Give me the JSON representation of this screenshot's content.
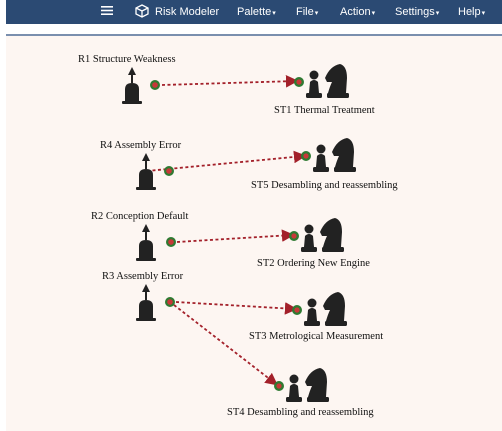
{
  "navbar": {
    "brand": "Risk Modeler",
    "menu": [
      {
        "label": "Palette"
      },
      {
        "label": "File"
      },
      {
        "label": "Action"
      },
      {
        "label": "Settings"
      },
      {
        "label": "Help"
      }
    ],
    "background_color": "#2b4a73"
  },
  "canvas": {
    "background_color": "#fdf6f2",
    "link_color": "#a3202a",
    "port_colors": {
      "inner": "#c83838",
      "outer": "#2f7a32"
    },
    "risks": [
      {
        "id": "R1",
        "label": "R1 Structure Weakness"
      },
      {
        "id": "R4",
        "label": "R4 Assembly Error"
      },
      {
        "id": "R2",
        "label": "R2 Conception Default"
      },
      {
        "id": "R3",
        "label": "R3 Assembly Error"
      }
    ],
    "strategies": [
      {
        "id": "ST1",
        "label": "ST1 Thermal Treatment"
      },
      {
        "id": "ST5",
        "label": "ST5 Desambling and reassembling"
      },
      {
        "id": "ST2",
        "label": "ST2 Ordering New Engine"
      },
      {
        "id": "ST3",
        "label": "ST3 Metrological Measurement"
      },
      {
        "id": "ST4",
        "label": "ST4 Desambling and reassembling"
      }
    ],
    "links": [
      {
        "from": "R1",
        "to": "ST1"
      },
      {
        "from": "R4",
        "to": "ST5"
      },
      {
        "from": "R2",
        "to": "ST2"
      },
      {
        "from": "R3",
        "to": "ST3"
      },
      {
        "from": "R3",
        "to": "ST4"
      }
    ]
  }
}
